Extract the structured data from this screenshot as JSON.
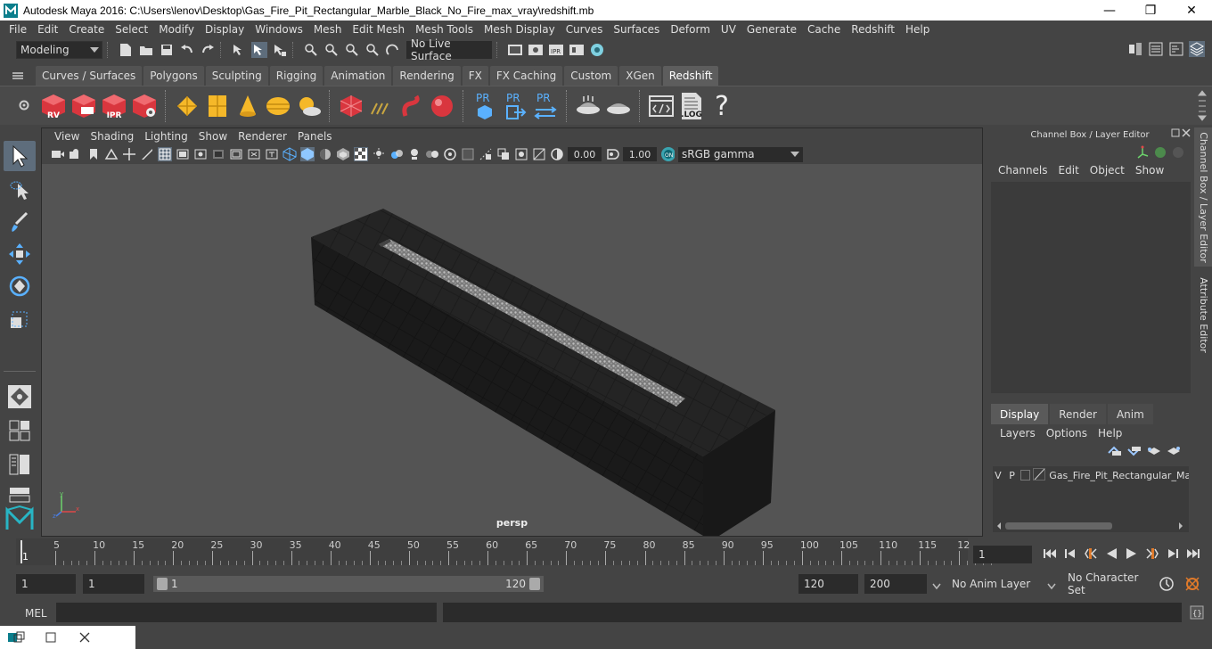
{
  "window": {
    "title": "Autodesk Maya 2016: C:\\Users\\lenov\\Desktop\\Gas_Fire_Pit_Rectangular_Marble_Black_No_Fire_max_vray\\redshift.mb",
    "minimize": "—",
    "restore": "❐",
    "close": "✕"
  },
  "menubar": [
    "File",
    "Edit",
    "Create",
    "Select",
    "Modify",
    "Display",
    "Windows",
    "Mesh",
    "Edit Mesh",
    "Mesh Tools",
    "Mesh Display",
    "Curves",
    "Surfaces",
    "Deform",
    "UV",
    "Generate",
    "Cache",
    "Redshift",
    "Help"
  ],
  "statusline": {
    "mode": "Modeling",
    "live_surface": "No Live Surface"
  },
  "shelf_tabs": [
    "Curves / Surfaces",
    "Polygons",
    "Sculpting",
    "Rigging",
    "Animation",
    "Rendering",
    "FX",
    "FX Caching",
    "Custom",
    "XGen",
    "Redshift"
  ],
  "shelf_active": "Redshift",
  "shelf_labels": {
    "rv": "RV",
    "ipr": "IPR",
    "pr1": "PR",
    "pr2": "PR",
    "pr3": "PR",
    "log": ".LOG",
    "help": "?"
  },
  "panel": {
    "menu": [
      "View",
      "Shading",
      "Lighting",
      "Show",
      "Renderer",
      "Panels"
    ],
    "exposure": "0.00",
    "gamma": "1.00",
    "colorspace": "sRGB gamma",
    "camera": "persp"
  },
  "right_panel": {
    "title": "Channel Box / Layer Editor",
    "channel_menu": [
      "Channels",
      "Edit",
      "Object",
      "Show"
    ],
    "tabs": [
      "Display",
      "Render",
      "Anim"
    ],
    "active_tab": "Display",
    "layer_menu": [
      "Layers",
      "Options",
      "Help"
    ],
    "layer": {
      "v": "V",
      "p": "P",
      "name": "Gas_Fire_Pit_Rectangular_Marble_Black"
    }
  },
  "vertical_tabs": [
    "Channel Box / Layer Editor",
    "Attribute Editor"
  ],
  "timeline": {
    "ticks": [
      "5",
      "10",
      "15",
      "20",
      "25",
      "30",
      "35",
      "40",
      "45",
      "50",
      "55",
      "60",
      "65",
      "70",
      "75",
      "80",
      "85",
      "90",
      "95",
      "100",
      "105",
      "110",
      "115",
      "12"
    ],
    "start_marker": "1",
    "current_frame": "1"
  },
  "range": {
    "start": "1",
    "start_inner": "1",
    "slider_start": "1",
    "slider_end": "120",
    "end_inner": "120",
    "end": "200",
    "anim_layer": "No Anim Layer",
    "char_set": "No Character Set"
  },
  "cmdline": {
    "label": "MEL"
  },
  "colors": {
    "accent": "#5e6d7c",
    "panel_bg": "#444444",
    "viewport_bg": "#545454"
  }
}
